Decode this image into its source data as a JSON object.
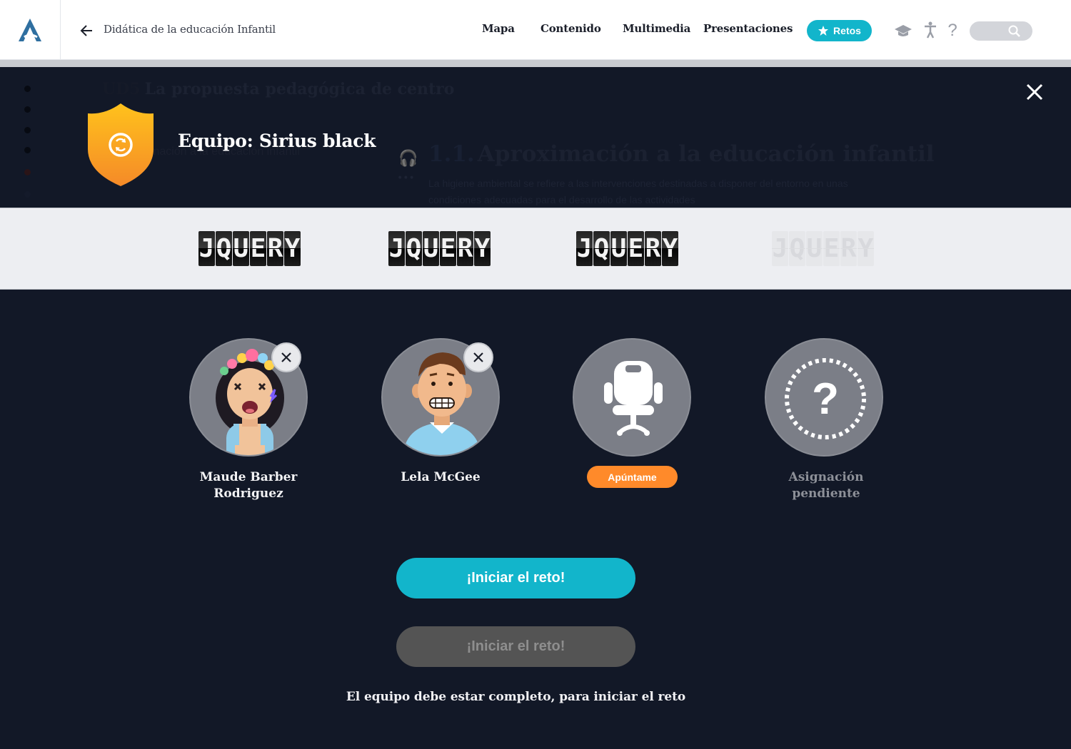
{
  "header": {
    "breadcrumb": "Didática de la educación Infantil",
    "nav": [
      "Mapa",
      "Contenido",
      "Multimedia",
      "Presentaciones"
    ],
    "retos_label": "Retos",
    "icons": [
      "logo-icon",
      "back-arrow-icon",
      "star-icon",
      "graduation-cap-icon",
      "accessibility-icon",
      "help-icon",
      "search-icon"
    ]
  },
  "background_page": {
    "unit_number": "UD5",
    "unit_title": "La propuesta pedagógica de centro",
    "unit_subtitle": "mación a la educación infantil",
    "section_number": "1.1.",
    "section_title": "Aproximación a la educación infantil",
    "section_text": "La higiene ambiental se refiere a las intervenciones destinadas a disponer del entorno en unas condiciones adecuadas para el desarrollo de las actividades"
  },
  "modal": {
    "team_title": "Equipo: Sirius black",
    "team_badge_icon": "shield-refresh-icon",
    "flip_words": [
      "JQUERY",
      "JQUERY",
      "JQUERY",
      "JQUERY"
    ],
    "members": [
      {
        "name_line1": "Maude Barber",
        "name_line2": "Rodriguez",
        "avatar": "flower-crown-woman-avatar"
      },
      {
        "name_line1": "Lela McGee",
        "name_line2": "",
        "avatar": "young-man-avatar"
      },
      {
        "name_line1": "",
        "name_line2": "",
        "avatar": "empty-chair-icon",
        "action_label": "Apúntame"
      },
      {
        "name_line1": "Asignación",
        "name_line2": "pendiente",
        "avatar": "question-mark-icon"
      }
    ],
    "start_label": "¡Iniciar el reto!",
    "start_disabled_label": "¡Iniciar el reto!",
    "hint": "El equipo debe estar completo, para iniciar el reto",
    "colors": {
      "accent": "#12b5cb",
      "orange": "#ff8a2a",
      "overlay": "#121827",
      "shield": "#f7a21a"
    }
  }
}
